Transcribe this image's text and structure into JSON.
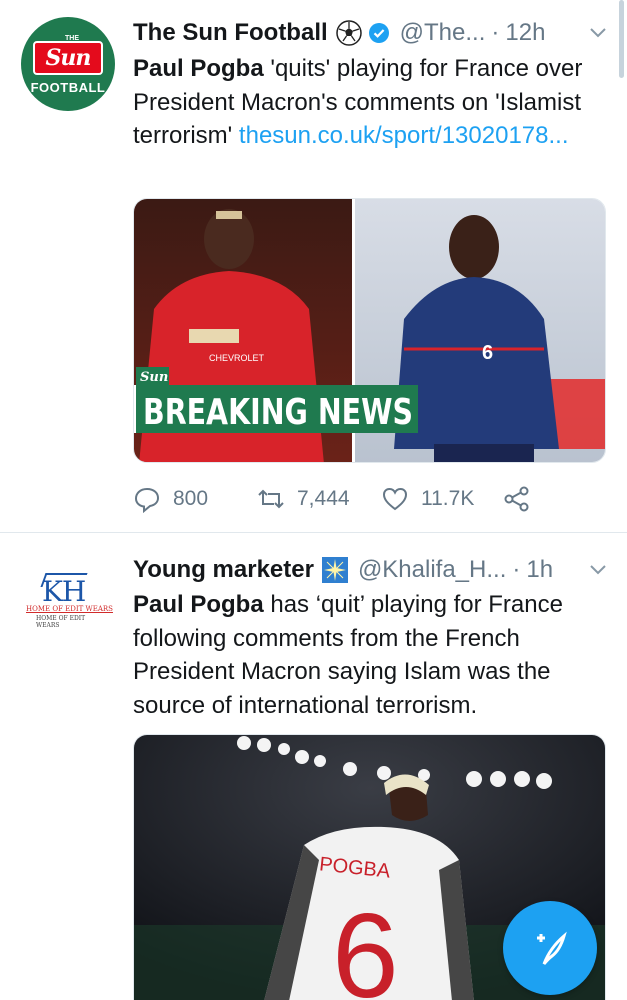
{
  "tweets": [
    {
      "avatar": {
        "title_small": "THE",
        "wordmark": "Sun",
        "subtitle": "FOOTBALL"
      },
      "author_name": "The Sun Football",
      "handle": "@The...",
      "separator": "·",
      "time": "12h",
      "text_bold": "Paul Pogba",
      "text_rest": " 'quits' playing for France over President Macron's comments on 'Islamist terrorism' ",
      "link": "thesun.co.uk/sport/13020178...",
      "media": {
        "badge": "Sun",
        "banner": "BREAKING NEWS",
        "sponsor": "CHEVROLET",
        "jersey_number": "6"
      },
      "stats": {
        "replies": "800",
        "retweets": "7,444",
        "likes": "11.7K"
      }
    },
    {
      "avatar": {
        "letters": "KH",
        "line1": "HOME OF EDIT WEARS",
        "line2": "HOME OF EDIT WEARS"
      },
      "author_name": "Young marketer",
      "handle": "@Khalifa_H...",
      "separator": "·",
      "time": "1h",
      "text_bold": "Paul Pogba",
      "text_rest": " has ‘quit’ playing for France following comments from the French President Macron saying Islam was the source of international terrorism.",
      "media": {
        "shirt_name": "POGBA",
        "jersey_number": "6"
      }
    }
  ],
  "colors": {
    "accent": "#1da1f2",
    "sun_red": "#e40b1c",
    "sun_green": "#1f7a4f"
  }
}
